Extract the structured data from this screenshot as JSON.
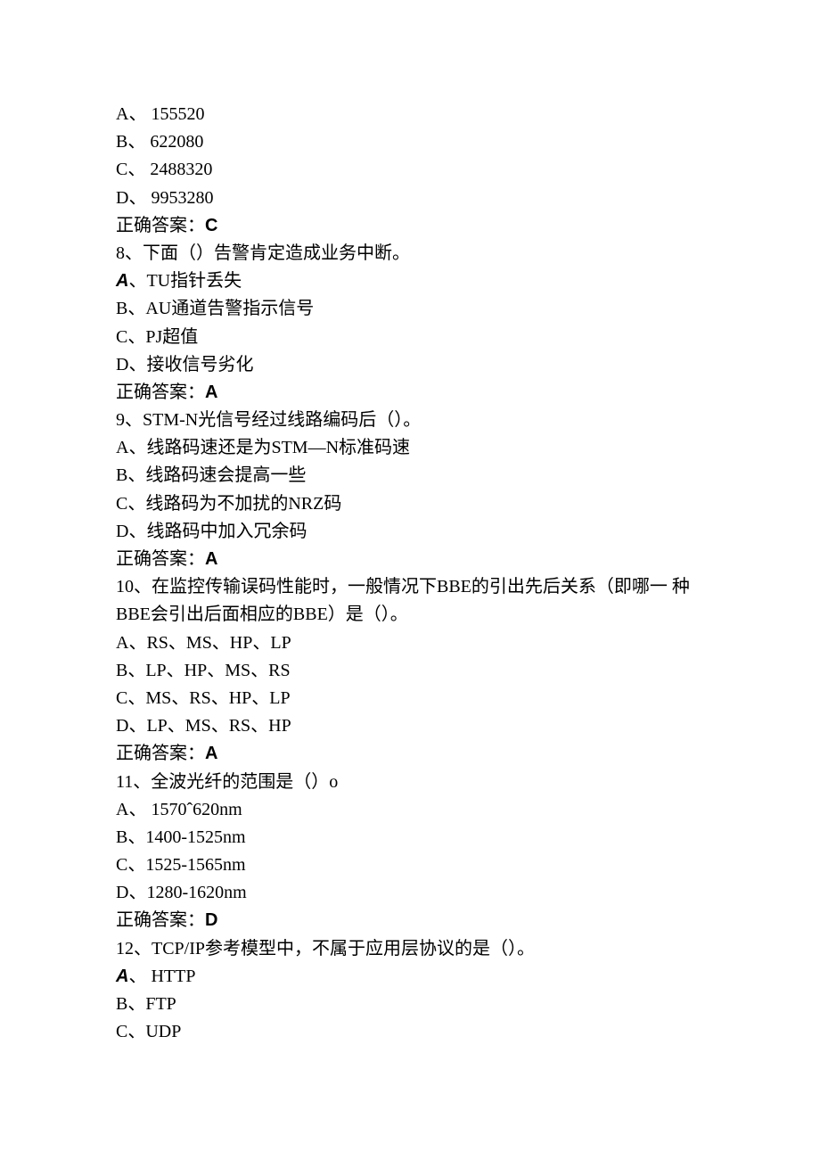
{
  "q7": {
    "optA": "A、 155520",
    "optB": "B、 622080",
    "optC": "C、 2488320",
    "optD": "D、 9953280",
    "ansLabel": "正确答案：",
    "ansValue": "C"
  },
  "q8": {
    "stem": "8、下面（）告警肯定造成业务中断。",
    "optA_prefix": "A",
    "optA_text": "、TU指针丢失",
    "optB": "B、AU通道告警指示信号",
    "optC": "C、PJ超值",
    "optD": "D、接收信号劣化",
    "ansLabel": "正确答案：",
    "ansValue": "A"
  },
  "q9": {
    "stem": "9、STM-N光信号经过线路编码后（）。",
    "optA": "A、线路码速还是为STM—N标准码速",
    "optB": "B、线路码速会提高一些",
    "optC": "C、线路码为不加扰的NRZ码",
    "optD": "D、线路码中加入冗余码",
    "ansLabel": "正确答案：",
    "ansValue": "A"
  },
  "q10": {
    "stem1": "10、在监控传输误码性能时，一般情况下BBE的引出先后关系（即哪一 种",
    "stem2": "BBE会引出后面相应的BBE）是（）。",
    "optA": "A、RS、MS、HP、LP",
    "optB": "B、LP、HP、MS、RS",
    "optC": "C、MS、RS、HP、LP",
    "optD": "D、LP、MS、RS、HP",
    "ansLabel": "正确答案：",
    "ansValue": "A"
  },
  "q11": {
    "stem": "11、全波光纤的范围是（）o",
    "optA": "A、 1570ˆ620nm",
    "optB": "B、1400-1525nm",
    "optC": "C、1525-1565nm",
    "optD": "D、1280-1620nm",
    "ansLabel": "正确答案：",
    "ansValue": "D"
  },
  "q12": {
    "stem": "12、TCP/IP参考模型中，不属于应用层协议的是（）。",
    "optA_prefix": "A",
    "optA_text": "、 HTTP",
    "optB": "B、FTP",
    "optC": "C、UDP"
  }
}
